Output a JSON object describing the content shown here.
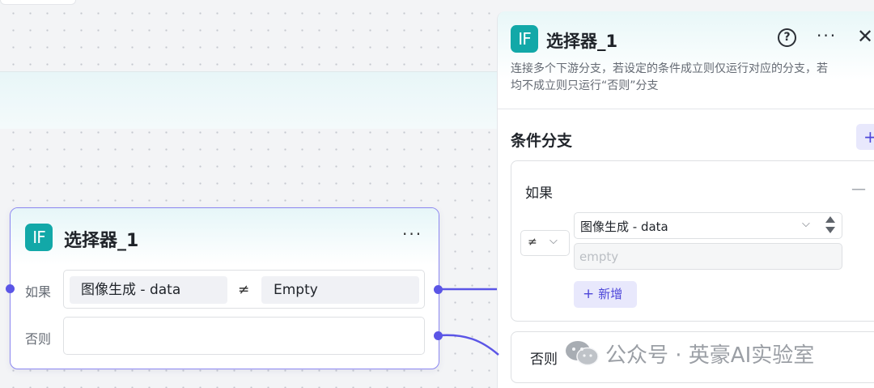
{
  "node": {
    "icon_text": "IF",
    "title": "选择器_1",
    "more": "···",
    "if_label": "如果",
    "else_label": "否则",
    "condition": {
      "variable": "图像生成  -  data",
      "operator": "≠",
      "value": "Empty"
    }
  },
  "panel": {
    "icon_text": "IF",
    "title": "选择器_1",
    "help": "?",
    "more": "···",
    "close": "✕",
    "description_line1": "连接多个下游分支，若设定的条件成立则仅运行对应的分支，若",
    "description_line2": "均不成立则只运行“否则”分支",
    "section_title": "条件分支",
    "add_branch": "+",
    "if_card": {
      "label": "如果",
      "remove": "—",
      "operator": "≠",
      "operator_chevron": "⌵",
      "variable": "图像生成 - data",
      "variable_chevron": "⌵",
      "value_placeholder": "empty",
      "add_condition_plus": "+",
      "add_condition_label": "新增"
    },
    "else_card": {
      "label": "否则"
    }
  },
  "watermark": {
    "text": "公众号 · 英豪AI实验室",
    "icon": "wechat-icon"
  },
  "colors": {
    "accent": "#5b55e6",
    "if_icon": "#12a8a8",
    "node_border": "#8b86f0"
  }
}
